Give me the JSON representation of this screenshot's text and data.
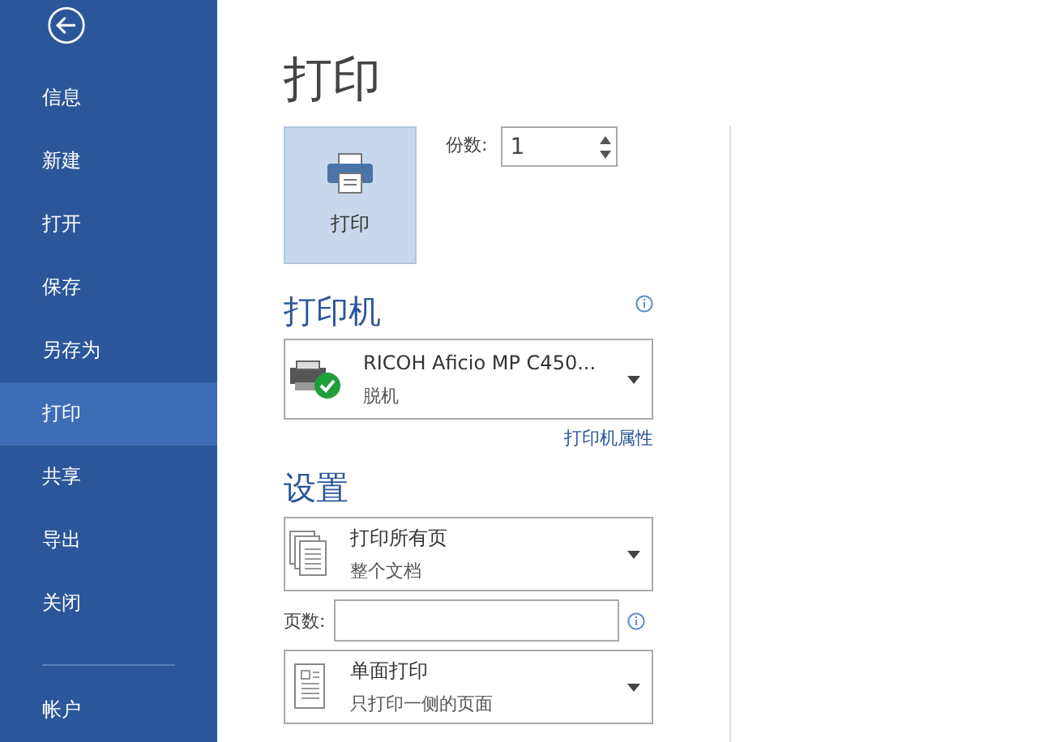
{
  "sidebar": {
    "items": [
      {
        "label": "信息",
        "selected": false
      },
      {
        "label": "新建",
        "selected": false
      },
      {
        "label": "打开",
        "selected": false
      },
      {
        "label": "保存",
        "selected": false
      },
      {
        "label": "另存为",
        "selected": false
      },
      {
        "label": "打印",
        "selected": true
      },
      {
        "label": "共享",
        "selected": false
      },
      {
        "label": "导出",
        "selected": false
      },
      {
        "label": "关闭",
        "selected": false
      }
    ],
    "footer_items": [
      {
        "label": "帐户",
        "selected": false
      }
    ]
  },
  "page_title": "打印",
  "print_button": {
    "label": "打印"
  },
  "copies": {
    "label": "份数:",
    "value": "1"
  },
  "printer": {
    "heading": "打印机",
    "name": "RICOH Aficio MP C450...",
    "status": "脱机",
    "properties_link": "打印机属性"
  },
  "settings": {
    "heading": "设置",
    "dropdowns": [
      {
        "kind": "pages",
        "title": "打印所有页",
        "subtitle": "整个文档"
      },
      {
        "kind": "sides",
        "title": "单面打印",
        "subtitle": "只打印一侧的页面"
      }
    ],
    "pages_field": {
      "label": "页数:"
    }
  }
}
